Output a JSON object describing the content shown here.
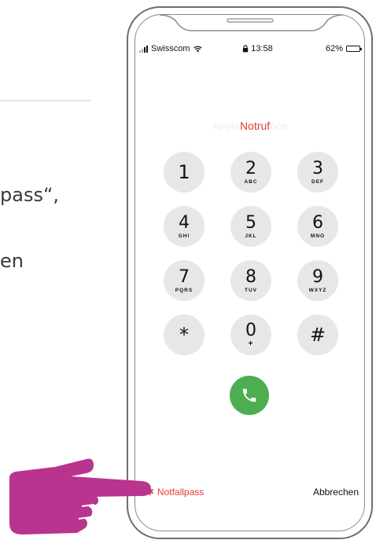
{
  "background": {
    "fragment_1": "pass“,",
    "fragment_2": "en"
  },
  "status_bar": {
    "carrier": "Swisscom",
    "time": "13:58",
    "battery": "62%",
    "battery_level": 0.62
  },
  "dialer": {
    "header_ghost_left": "Apple",
    "header_title": "Notruf",
    "header_ghost_right": "nce",
    "keys": [
      {
        "digit": "1",
        "letters": ""
      },
      {
        "digit": "2",
        "letters": "ABC"
      },
      {
        "digit": "3",
        "letters": "DEF"
      },
      {
        "digit": "4",
        "letters": "GHI"
      },
      {
        "digit": "5",
        "letters": "JKL"
      },
      {
        "digit": "6",
        "letters": "MNO"
      },
      {
        "digit": "7",
        "letters": "PQRS"
      },
      {
        "digit": "8",
        "letters": "TUV"
      },
      {
        "digit": "9",
        "letters": "WXYZ"
      },
      {
        "digit": "*",
        "letters": ""
      },
      {
        "digit": "0",
        "letters": "+"
      },
      {
        "digit": "#",
        "letters": ""
      }
    ],
    "emergency_label": "Notfallpass",
    "cancel_label": "Abbrechen"
  },
  "colors": {
    "accent_red": "#e53935",
    "call_green": "#4cae50",
    "hand": "#b8348e"
  },
  "icons": {
    "call": "phone-icon",
    "pointer": "pointing-hand-icon",
    "emergency": "asterisk-icon"
  }
}
